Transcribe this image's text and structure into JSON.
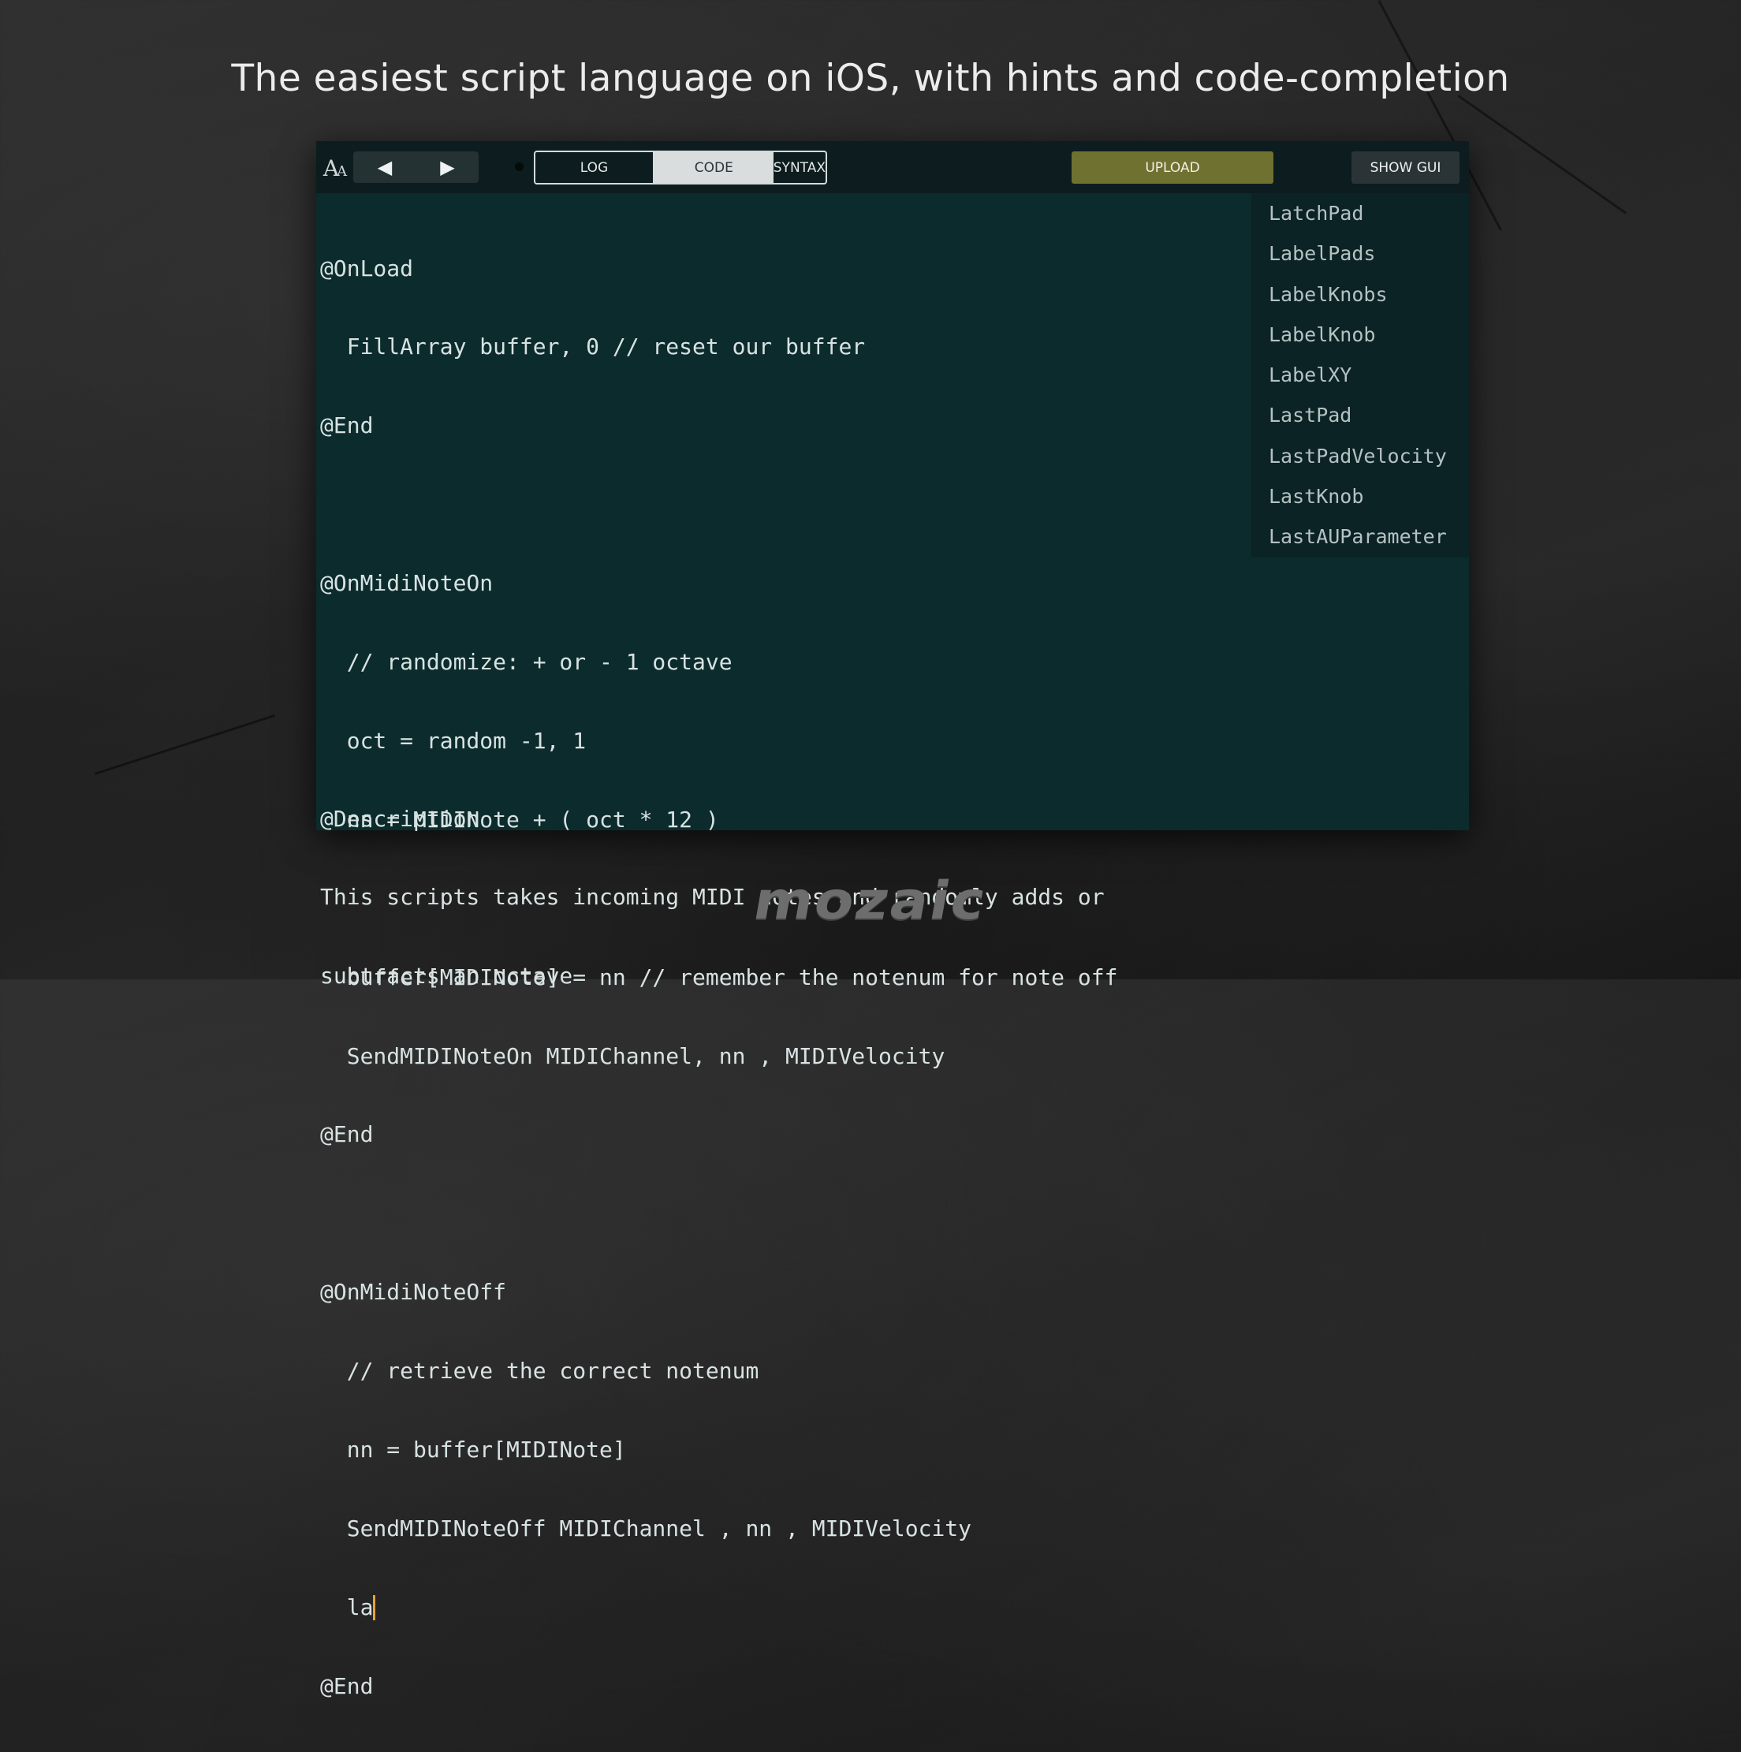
{
  "headline": "The easiest script language on iOS, with hints and code-completion",
  "toolbar": {
    "font_size_icon": "font-size-icon",
    "prev_label": "◀",
    "next_label": "▶",
    "tabs": [
      {
        "label": "LOG",
        "selected": false
      },
      {
        "label": "CODE",
        "selected": true
      },
      {
        "label": "SYNTAX",
        "selected": false
      }
    ],
    "upload_label": "UPLOAD",
    "show_gui_label": "SHOW GUI",
    "upload_color": "#6f7131"
  },
  "code_lines": [
    "@OnLoad",
    "  FillArray buffer, 0 // reset our buffer",
    "@End",
    "",
    "@OnMidiNoteOn",
    "  // randomize: + or - 1 octave",
    "  oct = random -1, 1",
    "  nn = MIDINote + ( oct * 12 )",
    "",
    "  buffer[MIDINote] = nn // remember the notenum for note off",
    "  SendMIDINoteOn MIDIChannel, nn , MIDIVelocity",
    "@End",
    "",
    "@OnMidiNoteOff",
    "  // retrieve the correct notenum",
    "  nn = buffer[MIDINote]",
    "  SendMIDINoteOff MIDIChannel , nn , MIDIVelocity",
    "  la",
    "@End"
  ],
  "description_lines": [
    "@Description",
    "This scripts takes incoming MIDI notes and randomly adds or",
    "subtracts an octave"
  ],
  "suggestions": [
    "LatchPad",
    "LabelPads",
    "LabelKnobs",
    "LabelKnob",
    "LabelXY",
    "LastPad",
    "LastPadVelocity",
    "LastKnob",
    "LastAUParameter"
  ],
  "logo_text": "mozaic",
  "colors": {
    "editor_bg": "#0c2b2c",
    "caret": "#e6a23a",
    "selected_tab_bg": "#d9dddd"
  }
}
